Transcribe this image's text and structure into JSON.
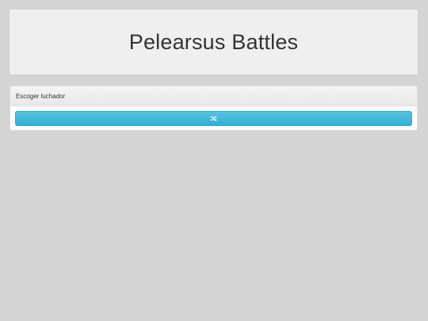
{
  "header": {
    "title": "Pelearsus Battles"
  },
  "fighter_panel": {
    "heading": "Escoger luchador",
    "random_button": {
      "icon": "shuffle-icon"
    }
  },
  "colors": {
    "background": "#d4d4d4",
    "header_bg": "#efefef",
    "button_accent": "#5bc0de"
  }
}
